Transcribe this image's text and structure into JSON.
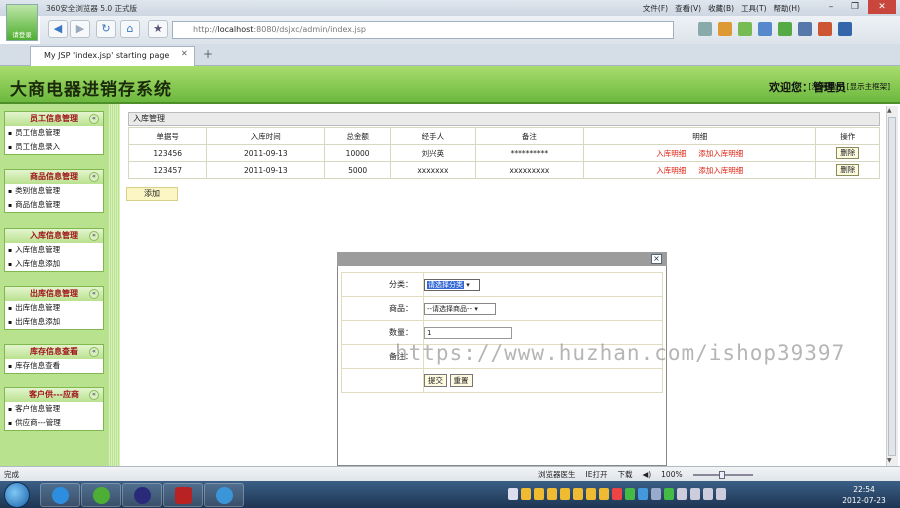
{
  "browser": {
    "title": "360安全浏览器 5.0 正式版",
    "menu": [
      "文件(F)",
      "查看(V)",
      "收藏(B)",
      "工具(T)",
      "帮助(H)"
    ],
    "avatar_label": "请登录",
    "address_prefix": "http://",
    "address_host": "localhost",
    "address_rest": ":8080/dsjxc/admin/index.jsp",
    "tab_title": "My JSP 'index.jsp' starting page",
    "status_text": "完成",
    "status_right": [
      "浏览器医生",
      "IE打开",
      "下载"
    ],
    "zoom": "100%"
  },
  "app": {
    "title": "大商电器进销存系统",
    "welcome": "欢迎您：管理员",
    "logout": "[注销退出]",
    "show_frame": "[显示主框架]"
  },
  "sidebar": {
    "groups": [
      {
        "title": "员工信息管理",
        "items": [
          "员工信息管理",
          "员工信息录入"
        ]
      },
      {
        "title": "商品信息管理",
        "items": [
          "类别信息管理",
          "商品信息管理"
        ]
      },
      {
        "title": "入库信息管理",
        "items": [
          "入库信息管理",
          "入库信息添加"
        ]
      },
      {
        "title": "出库信息管理",
        "items": [
          "出库信息管理",
          "出库信息添加"
        ]
      },
      {
        "title": "库存信息查看",
        "items": [
          "库存信息查看"
        ]
      },
      {
        "title": "客户供---应商",
        "items": [
          "客户信息管理",
          "供应商---管理"
        ]
      }
    ]
  },
  "main": {
    "panel_title": "入库管理",
    "columns": [
      "单据号",
      "入库时间",
      "总金额",
      "经手人",
      "备注",
      "明细",
      "操作"
    ],
    "rows": [
      {
        "id": "123456",
        "time": "2011-09-13",
        "amount": "10000",
        "handler": "刘兴英",
        "note": "**********",
        "detail": "入库明细",
        "add_detail": "添加入库明细",
        "action": "删除"
      },
      {
        "id": "123457",
        "time": "2011-09-13",
        "amount": "5000",
        "handler": "xxxxxxx",
        "note": "xxxxxxxxx",
        "detail": "入库明细",
        "add_detail": "添加入库明细",
        "action": "删除"
      }
    ],
    "add_label": "添加"
  },
  "dialog": {
    "close": "×",
    "category_label": "分类：",
    "category_value": "请选择分类",
    "product_label": "商品：",
    "product_value": "--请选择商品--",
    "qty_label": "数量：",
    "qty_value": "1",
    "note_label": "备注：",
    "submit": "提交",
    "reset": "重置"
  },
  "watermark": "https://www.huzhan.com/ishop39397",
  "taskbar": {
    "time": "22:54",
    "date": "2012-07-23"
  },
  "colors": {
    "header_green": "#6cb83e",
    "sidebar_green": "#b8e28e",
    "group_title_red": "#a0121a",
    "link_red": "#d21"
  }
}
